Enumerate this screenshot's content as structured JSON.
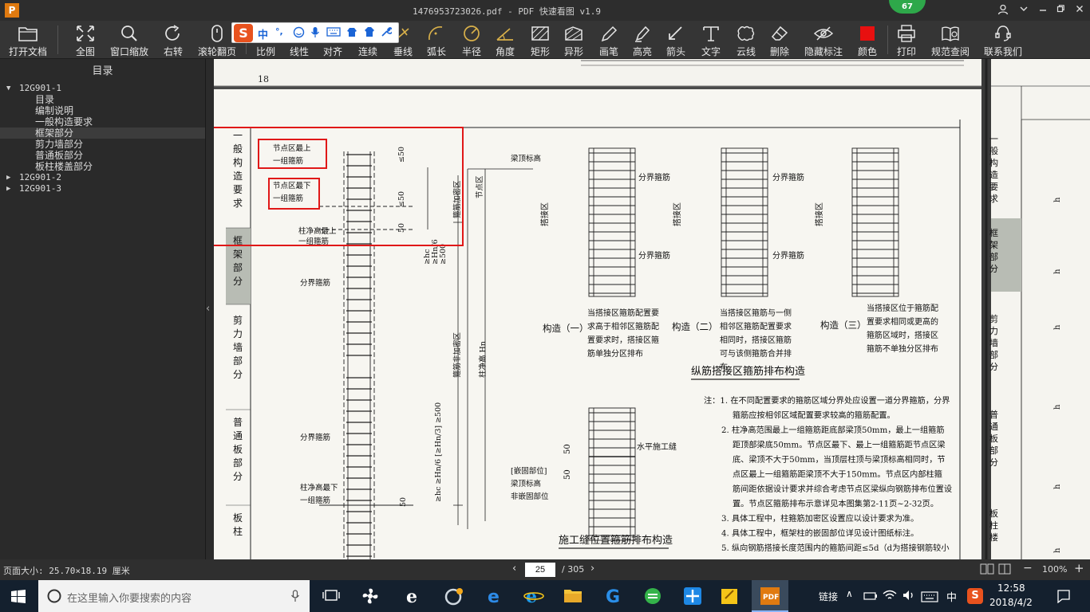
{
  "window": {
    "title": "1476953723026.pdf - PDF 快速看图 v1.9",
    "badge": "67",
    "logo": "P"
  },
  "toolbar": [
    {
      "id": "open",
      "label": "打开文档",
      "icon": "folder-icon"
    },
    {
      "id": "fit",
      "label": "全图",
      "icon": "expand-icon"
    },
    {
      "id": "zoomwin",
      "label": "窗口缩放",
      "icon": "magnifier-icon"
    },
    {
      "id": "rotate",
      "label": "右转",
      "icon": "rotate-icon"
    },
    {
      "id": "wheel",
      "label": "滚轮翻页",
      "icon": "mouse-icon"
    },
    {
      "id": "scale",
      "label": "比例",
      "icon": "ruler-icon"
    },
    {
      "id": "linear",
      "label": "线性",
      "icon": "line-icon"
    },
    {
      "id": "align",
      "label": "对齐",
      "icon": "align-icon"
    },
    {
      "id": "cont",
      "label": "连续",
      "icon": "polyline-icon"
    },
    {
      "id": "perp",
      "label": "垂线",
      "icon": "perpendicular-icon"
    },
    {
      "id": "arc",
      "label": "弧长",
      "icon": "arc-icon"
    },
    {
      "id": "radius",
      "label": "半径",
      "icon": "radius-icon"
    },
    {
      "id": "angle",
      "label": "角度",
      "icon": "angle-icon"
    },
    {
      "id": "rect",
      "label": "矩形",
      "icon": "rect-hatch-icon"
    },
    {
      "id": "irregular",
      "label": "异形",
      "icon": "irregular-icon"
    },
    {
      "id": "pen",
      "label": "画笔",
      "icon": "pen-icon"
    },
    {
      "id": "highlight",
      "label": "高亮",
      "icon": "highlighter-icon"
    },
    {
      "id": "arrow",
      "label": "箭头",
      "icon": "arrow-icon"
    },
    {
      "id": "text",
      "label": "文字",
      "icon": "text-icon"
    },
    {
      "id": "cloud",
      "label": "云线",
      "icon": "cloud-icon"
    },
    {
      "id": "delete",
      "label": "删除",
      "icon": "eraser-icon"
    },
    {
      "id": "hide",
      "label": "隐藏标注",
      "icon": "eye-off-icon"
    },
    {
      "id": "color",
      "label": "颜色",
      "icon": "color-swatch-icon"
    },
    {
      "id": "print",
      "label": "打印",
      "icon": "printer-icon"
    },
    {
      "id": "norms",
      "label": "规范查阅",
      "icon": "book-icon"
    },
    {
      "id": "contact",
      "label": "联系我们",
      "icon": "support-icon"
    }
  ],
  "ime": {
    "logo": "S",
    "mode": "中",
    "punct": "°,"
  },
  "colors": {
    "accent": "#e81010",
    "annotation": "#e01818",
    "highlightCell": "#b8bcb4"
  },
  "sidebar": {
    "title": "目录",
    "tree": [
      {
        "label": "12G901-1",
        "level": 0,
        "expanded": true
      },
      {
        "label": "目录",
        "level": 1
      },
      {
        "label": "编制说明",
        "level": 1
      },
      {
        "label": "一般构造要求",
        "level": 1
      },
      {
        "label": "框架部分",
        "level": 1,
        "selected": true
      },
      {
        "label": "剪力墙部分",
        "level": 1
      },
      {
        "label": "普通板部分",
        "level": 1
      },
      {
        "label": "板柱楼盖部分",
        "level": 1
      },
      {
        "label": "12G901-2",
        "level": 0,
        "expanded": false
      },
      {
        "label": "12G901-3",
        "level": 0,
        "expanded": false
      }
    ]
  },
  "document": {
    "page_number_top": "18",
    "side_tabs": [
      "一般构造要求",
      "框架部分",
      "剪力墙部分",
      "普通板部分",
      "板柱"
    ],
    "right_tabs": [
      "一般构造要求",
      "框架部分",
      "剪力墙部分",
      "普通板部分",
      "板柱楼"
    ],
    "col_labels": {
      "top_group_1": "节点区最上",
      "top_group_2": "一组箍筋",
      "bot_group_1": "节点区最下",
      "bot_group_2": "一组箍筋",
      "col_top_1": "柱净高最上",
      "col_top_2": "一组箍筋",
      "boundary": "分界箍筋",
      "boundary2": "分界箍筋",
      "col_bot_1": "柱净高最下",
      "col_bot_2": "一组箍筋",
      "dim50a": "≤50",
      "dim50b": "≤50",
      "dim50c": "50",
      "dim50d": "50",
      "beam_top": "梁顶标高",
      "node_zone": "节点区",
      "dense_zone": "箍筋加密区",
      "non_dense": "箍筋非加密区",
      "clear_height": "柱净高 Hn",
      "hn6_top": "≥hc\n≥Hn/6\n≥500",
      "hn3_bot": "≥hc ≥Hn/6 [≥Hn/3] ≥500",
      "embed_1": "[嵌固部位]",
      "embed_2": "梁顶标高",
      "embed_3": "非嵌固部位"
    },
    "splice": {
      "zone": "搭接区",
      "boundary": "分界箍筋",
      "c1_label": "构造（一）",
      "c1_text": "当搭接区箍筋配置要求高于相邻区箍筋配置要求时，搭接区箍筋单独分区排布",
      "c2_label": "构造（二）",
      "c2_text": "当搭接区箍筋与一侧相邻区箍筋配置要求相同时，搭接区箍筋可与该侧箍筋合并排布",
      "c3_label": "构造（三）",
      "c3_text": "当搭接区位于箍筋配置要求相同或更高的箍筋区域时，搭接区箍筋不单独分区排布",
      "title": "纵筋搭接区箍筋排布构造"
    },
    "construction_joint": {
      "label": "水平施工缝",
      "dim1": "50",
      "dim2": "50",
      "title": "施工缝位置箍筋排布构造"
    },
    "notes": [
      "注：1. 在不同配置要求的箍筋区域分界处应设置一道分界箍筋，分界",
      "箍筋应按相邻区域配置要求较高的箍筋配置。",
      "2. 柱净高范围最上一组箍筋距底部梁顶50mm，最上一组箍筋",
      "距顶部梁底50mm。节点区最下、最上一组箍筋距节点区梁",
      "底、梁顶不大于50mm，当顶层柱顶与梁顶标高相同时，节",
      "点区最上一组箍筋距梁顶不大于150mm。节点区内部柱箍",
      "筋间距依据设计要求并综合考虑节点区梁纵向钢筋排布位置设",
      "置。节点区箍筋排布示意详见本图集第2-11页~2-32页。",
      "3. 具体工程中，柱箍筋加密区设置应以设计要求为准。",
      "4. 具体工程中，框架柱的嵌固部位详见设计图纸标注。",
      "5. 纵向钢筋搭接长度范围内的箍筋间距≤5d（d为搭接钢筋较小"
    ],
    "right_h": "h"
  },
  "status": {
    "page_size": "页面大小: 25.70×18.19 厘米",
    "current_page": "25",
    "total_pages": "/ 305",
    "zoom": "100%"
  },
  "taskbar": {
    "search_placeholder": "在这里输入你要搜索的内容",
    "tray_link": "链接",
    "tray_ime": "中",
    "time": "12:58",
    "date": "2018/4/2"
  }
}
